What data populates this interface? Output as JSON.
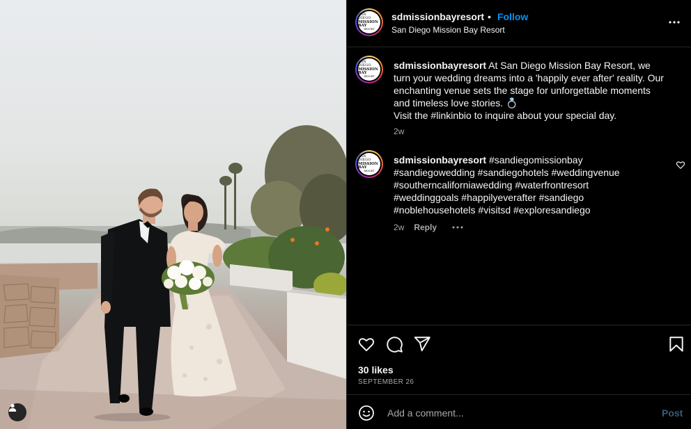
{
  "post": {
    "username": "sdmissionbayresort",
    "follow_label": "Follow",
    "separator": "•",
    "location": "San Diego Mission Bay Resort",
    "avatar_logo": {
      "line1": "SAN DIEGO",
      "line2": "MISSION BAY",
      "line3": "RESORT"
    }
  },
  "caption": {
    "username": "sdmissionbayresort",
    "text": " At San Diego Mission Bay Resort, we turn your wedding dreams into a 'happily ever after' reality. Our enchanting venue sets the stage for unforgettable moments and timeless love stories. 💍",
    "line2": "Visit the #linkinbio to inquire about your special day.",
    "time": "2w"
  },
  "comment": {
    "username": "sdmissionbayresort",
    "text": " #sandiegomissionbay #sandiegowedding #sandiegohotels #weddingvenue #southerncaliforniawedding #waterfrontresort #weddinggoals #happilyeverafter #sandiego #noblehousehotels #visitsd #exploresandiego",
    "time": "2w",
    "reply_label": "Reply"
  },
  "stats": {
    "likes": "30 likes",
    "date": "SEPTEMBER 26"
  },
  "add_comment": {
    "placeholder": "Add a comment...",
    "post_label": "Post"
  },
  "icons": {
    "more": "more-horizontal-icon",
    "like": "heart-icon",
    "comment": "comment-icon",
    "share": "share-icon",
    "save": "bookmark-icon",
    "emoji": "emoji-icon",
    "user_tag": "user-tag-icon"
  },
  "colors": {
    "follow": "#0095f6",
    "post_disabled": "#3b5b7a",
    "secondary_text": "#a8a8a8",
    "divider": "#262626"
  }
}
